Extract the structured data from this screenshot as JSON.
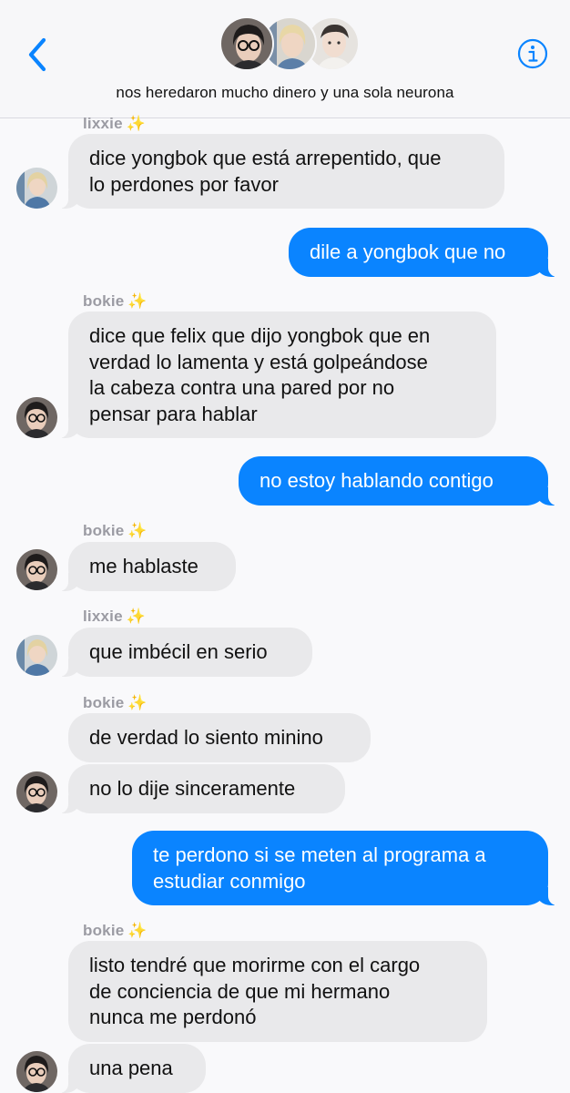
{
  "header": {
    "group_name": "nos heredaron mucho dinero y una sola neurona",
    "accent_color": "#0a84ff",
    "back_icon": "chevron-left-icon",
    "info_icon": "info-circle-icon"
  },
  "senders": {
    "lixxie": "lixxie",
    "bokie": "bokie",
    "sparkle": "✨"
  },
  "messages": [
    {
      "from": "lixxie",
      "lines": [
        "dice yongbok que está arrepentido, que",
        "lo perdones por favor"
      ]
    },
    {
      "from": "me",
      "lines": [
        "dile a yongbok que no"
      ]
    },
    {
      "from": "bokie",
      "lines": [
        "dice que felix que dijo yongbok que en",
        "verdad lo lamenta y está golpeándose",
        "la cabeza contra una pared por no",
        "pensar para hablar"
      ]
    },
    {
      "from": "me",
      "lines": [
        "no estoy hablando contigo"
      ]
    },
    {
      "from": "bokie",
      "lines": [
        "me hablaste"
      ]
    },
    {
      "from": "lixxie",
      "lines": [
        "que imbécil en serio"
      ]
    },
    {
      "from": "bokie",
      "lines": [
        "de verdad lo siento minino"
      ]
    },
    {
      "from": "bokie",
      "lines": [
        "no lo dije sinceramente"
      ]
    },
    {
      "from": "me",
      "lines": [
        "te perdono si se meten al programa a",
        "estudiar conmigo"
      ]
    },
    {
      "from": "bokie",
      "lines": [
        "listo tendré que morirme con el cargo",
        "de conciencia de que mi hermano",
        "nunca me perdonó"
      ]
    },
    {
      "from": "bokie",
      "lines": [
        "una pena"
      ]
    }
  ]
}
